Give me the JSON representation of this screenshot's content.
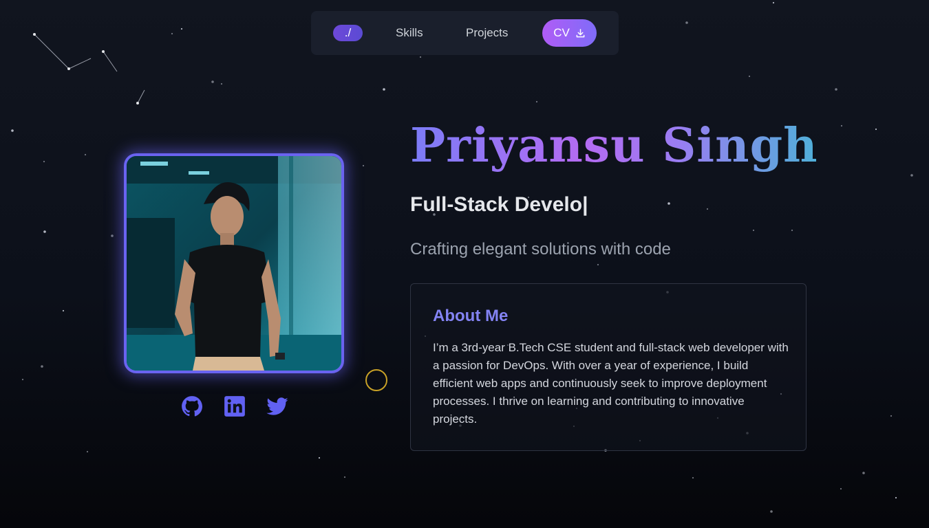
{
  "nav": {
    "home_label": "./",
    "skills_label": "Skills",
    "projects_label": "Projects",
    "cv_label": "CV",
    "cv_icon": "download-icon"
  },
  "profile": {
    "photo": "profile-photo",
    "socials": [
      {
        "name": "github-icon",
        "color": "#6161f2"
      },
      {
        "name": "linkedin-icon",
        "color": "#6161f2"
      },
      {
        "name": "twitter-icon",
        "color": "#6161f2"
      }
    ]
  },
  "hero": {
    "name": "Priyansu Singh",
    "role": "Full-Stack Develo|",
    "tagline": "Crafting elegant solutions with code"
  },
  "about": {
    "title": "About Me",
    "text": "I’m a 3rd-year B.Tech CSE student and full-stack web developer with a passion for DevOps. With over a year of experience, I build efficient web apps and continuously seek to improve deployment processes. I thrive on learning and contributing to innovative projects."
  },
  "colors": {
    "accent": "#6a63f0",
    "about_title": "#8383f3",
    "cv_gradient_start": "#b05cf6",
    "cv_gradient_end": "#7f6cf8",
    "background": "#0c101a"
  }
}
